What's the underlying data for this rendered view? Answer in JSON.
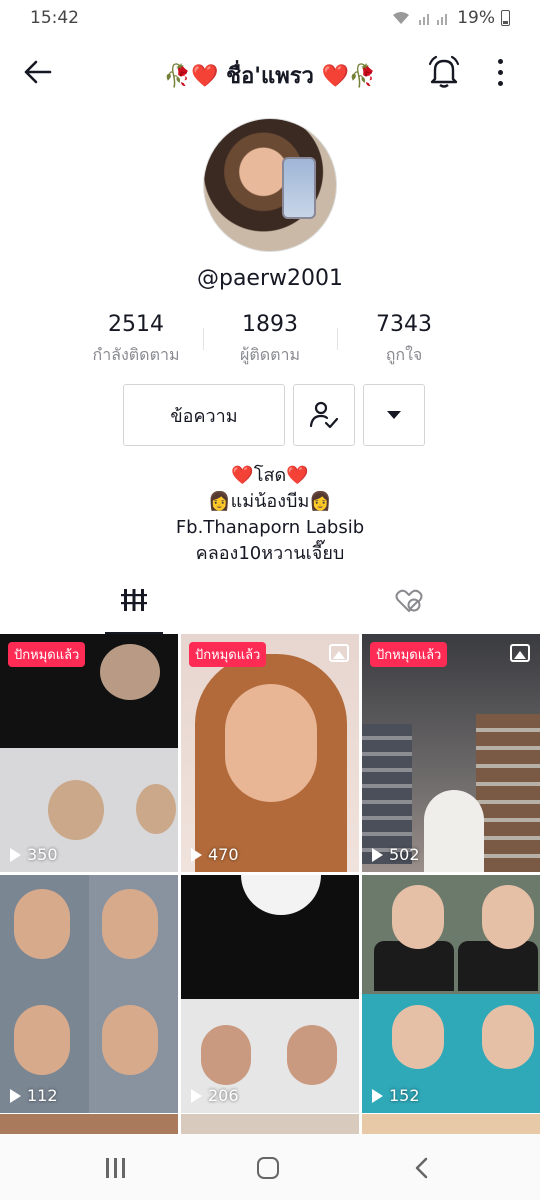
{
  "status_bar": {
    "time": "15:42",
    "battery": "19%"
  },
  "header": {
    "title": "🥀❤️ ชื่อ'แพรว ❤️🥀"
  },
  "profile": {
    "handle": "@paerw2001",
    "stats": [
      {
        "value": "2514",
        "label": "กำลังติดตาม"
      },
      {
        "value": "1893",
        "label": "ผู้ติดตาม"
      },
      {
        "value": "7343",
        "label": "ถูกใจ"
      }
    ],
    "message_button": "ข้อความ",
    "bio": [
      "❤️โสด❤️",
      "👩แม่น้องบีม👩",
      "Fb.Thanaporn Labsib",
      "คลอง10หวานเจี๊ยบ"
    ]
  },
  "videos": [
    {
      "pinned_label": "ปักหมุดแล้ว",
      "views": "350",
      "photo": false
    },
    {
      "pinned_label": "ปักหมุดแล้ว",
      "views": "470",
      "photo": true
    },
    {
      "pinned_label": "ปักหมุดแล้ว",
      "views": "502",
      "photo": true
    },
    {
      "pinned_label": "",
      "views": "112",
      "photo": false
    },
    {
      "pinned_label": "",
      "views": "206",
      "photo": false
    },
    {
      "pinned_label": "",
      "views": "152",
      "photo": false
    }
  ],
  "colors": {
    "accent": "#fe2c55",
    "text": "#161823",
    "muted": "#8a8b91"
  },
  "icons": [
    "back-arrow-icon",
    "bell-icon",
    "more-vertical-icon",
    "person-check-icon",
    "dropdown-triangle-icon",
    "grid-videos-icon",
    "liked-hidden-icon",
    "play-icon",
    "photo-icon"
  ]
}
